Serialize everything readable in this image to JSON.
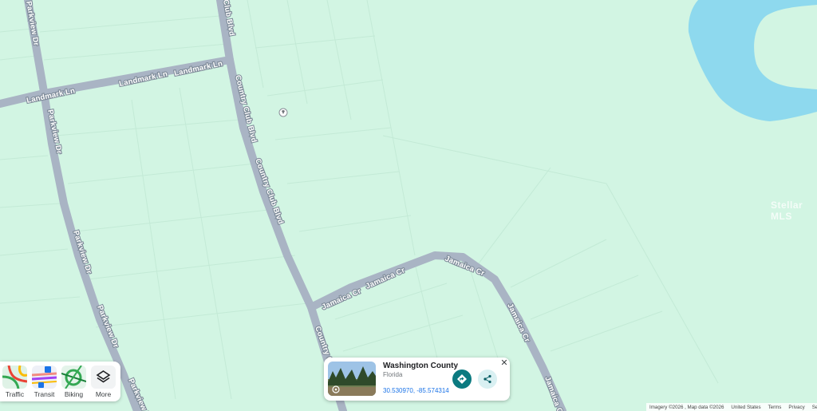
{
  "map": {
    "colors": {
      "land": "#d2f5e3",
      "road": "#a9b4c4",
      "water": "#8ed9ee",
      "parcel": "#c3ead6"
    },
    "road_labels": {
      "parkview_dr_1": "Parkview Dr",
      "parkview_dr_2": "Parkview Dr",
      "parkview_dr_3": "Parkview Dr",
      "parkview_dr_4": "Parkview Dr",
      "parkview_dr_5": "Parkview Dr",
      "country_club_1": "Country Club Blvd",
      "country_club_2": "Country Club Blvd",
      "country_club_3": "Country Club Blvd",
      "country_club_4": "Country Club Blvd",
      "landmark_ln_1": "Landmark Ln",
      "landmark_ln_2": "Landmark Ln",
      "landmark_ln_3": "Landmark Ln",
      "jamaica_cr_1": "Jamaica Cr",
      "jamaica_cr_2": "Jamaica Cr",
      "jamaica_cr_3": "Jamaica Cr",
      "jamaica_cr_4": "Jamaica Cr",
      "jamaica_cr_5": "Jamaica Cr"
    },
    "watermark": "Stellar MLS",
    "pin_icon": "location-pin-icon"
  },
  "layers": [
    {
      "label": "Traffic",
      "icon": "traffic-layer-icon"
    },
    {
      "label": "Transit",
      "icon": "transit-layer-icon"
    },
    {
      "label": "Biking",
      "icon": "biking-layer-icon"
    },
    {
      "label": "More",
      "icon": "layers-stack-icon"
    }
  ],
  "card": {
    "title": "Washington County",
    "subtitle": "Florida",
    "coords": "30.530970, -85.574314",
    "photo_icon": "street-view-icon",
    "directions_icon": "directions-icon",
    "share_icon": "share-icon",
    "close_icon": "close-icon"
  },
  "footer": {
    "imagery": "Imagery ©2026 , Map data ©2026",
    "country": "United States",
    "terms": "Terms",
    "privacy": "Privacy",
    "send": "Se"
  }
}
